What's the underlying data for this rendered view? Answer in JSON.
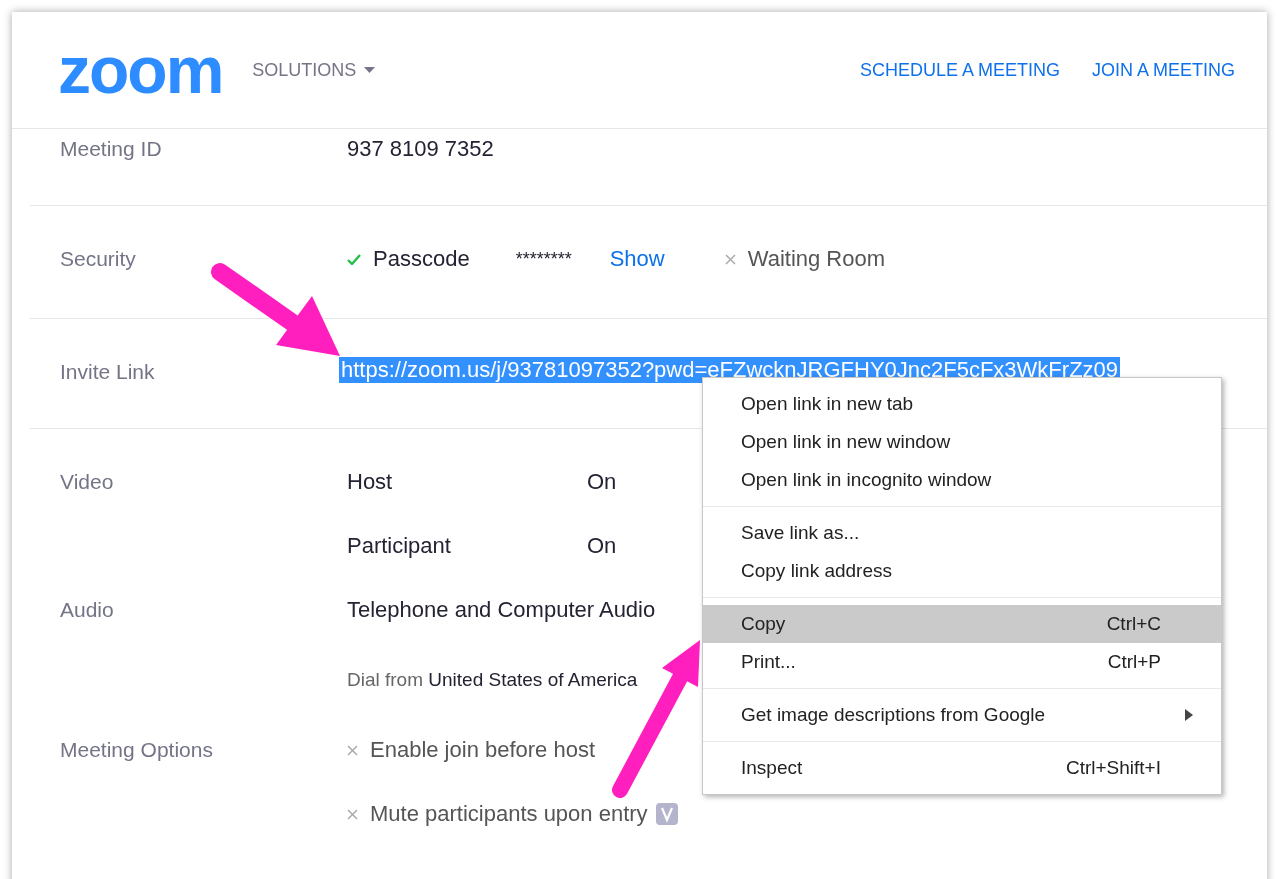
{
  "header": {
    "logo": "zoom",
    "menu": "SOLUTIONS",
    "links": [
      "SCHEDULE A MEETING",
      "JOIN A MEETING"
    ]
  },
  "details": [
    {
      "label": "Meeting ID",
      "kind": "text",
      "value": "937 8109 7352",
      "divider": true
    },
    {
      "label": "Security",
      "kind": "security",
      "divider": true,
      "items": [
        {
          "text": "Passcode",
          "enabled": true,
          "secret": "********",
          "action": "Show"
        },
        {
          "text": "Waiting Room",
          "enabled": false
        }
      ]
    },
    {
      "label": "Invite Link",
      "kind": "link",
      "value": "https://zoom.us/j/93781097352?pwd=eFZwcknJRGFHY0Jnc2F5cFx3WkFrZz09",
      "selected": true,
      "divider": true
    },
    {
      "label": "Video",
      "kind": "pairs",
      "divider": false,
      "pairs": [
        {
          "name": "Host",
          "value": "On"
        },
        {
          "name": "Participant",
          "value": "On"
        }
      ]
    },
    {
      "label": "Audio",
      "kind": "audio",
      "divider": false,
      "value": "Telephone and Computer Audio",
      "note": "Dial from **United States of America**"
    },
    {
      "label": "Meeting Options",
      "kind": "options",
      "divider": false,
      "items": [
        {
          "text": "Enable join before host",
          "enabled": false,
          "badge": false
        },
        {
          "text": "Mute participants upon entry",
          "enabled": false,
          "badge": true
        }
      ]
    }
  ],
  "context_menu": [
    [
      {
        "label": "Open link in new tab",
        "selected": false
      },
      {
        "label": "Open link in new window",
        "selected": false
      },
      {
        "label": "Open link in incognito window",
        "selected": false
      }
    ],
    [
      {
        "label": "Save link as...",
        "selected": false
      },
      {
        "label": "Copy link address",
        "selected": false
      }
    ],
    [
      {
        "label": "Copy",
        "shortcut": "Ctrl+C",
        "selected": true
      },
      {
        "label": "Print...",
        "shortcut": "Ctrl+P",
        "selected": false
      }
    ],
    [
      {
        "label": "Get image descriptions from Google",
        "submenu": true,
        "selected": false
      }
    ],
    [
      {
        "label": "Inspect",
        "shortcut": "Ctrl+Shift+I",
        "selected": false
      }
    ]
  ]
}
